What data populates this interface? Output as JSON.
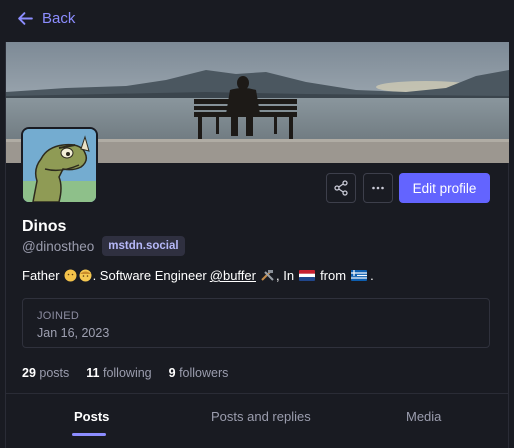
{
  "nav": {
    "back_label": "Back",
    "back_icon": "arrow-left-icon"
  },
  "profile": {
    "display_name": "Dinos",
    "handle": "@dinostheo",
    "domain": "mstdn.social",
    "bio": {
      "part1": "Father",
      "part2": ". Software Engineer",
      "mention": "@buffer",
      "part3": ", In",
      "part4": "from",
      "part5": "."
    },
    "joined_label": "JOINED",
    "joined_date": "Jan 16, 2023"
  },
  "actions": {
    "share_icon": "share-icon",
    "more_icon": "more-icon",
    "edit_label": "Edit profile"
  },
  "stats": [
    {
      "count": "29",
      "label": "posts"
    },
    {
      "count": "11",
      "label": "following"
    },
    {
      "count": "9",
      "label": "followers"
    }
  ],
  "tabs": [
    {
      "label": "Posts",
      "active": true
    },
    {
      "label": "Posts and replies",
      "active": false
    },
    {
      "label": "Media",
      "active": false
    }
  ],
  "colors": {
    "accent": "#6364ff",
    "link": "#8c8dff",
    "background": "#191b22"
  }
}
